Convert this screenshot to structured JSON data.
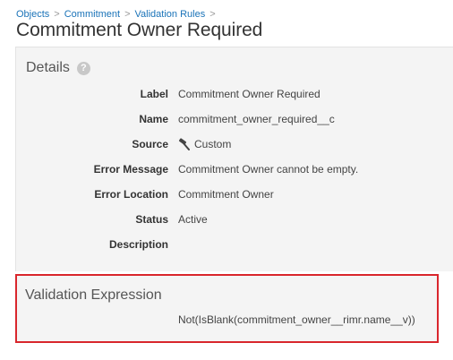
{
  "breadcrumb": {
    "items": [
      "Objects",
      "Commitment",
      "Validation Rules"
    ],
    "separator": ">"
  },
  "page_title": "Commitment Owner Required",
  "details": {
    "header": "Details",
    "help_icon": "?",
    "fields": [
      {
        "label": "Label",
        "value": "Commitment Owner Required"
      },
      {
        "label": "Name",
        "value": "commitment_owner_required__c"
      },
      {
        "label": "Source",
        "value": "Custom",
        "icon": "hammer-icon"
      },
      {
        "label": "Error Message",
        "value": "Commitment Owner cannot be empty."
      },
      {
        "label": "Error Location",
        "value": "Commitment Owner"
      },
      {
        "label": "Status",
        "value": "Active"
      },
      {
        "label": "Description",
        "value": ""
      }
    ]
  },
  "validation": {
    "header": "Validation Expression",
    "expression": "Not(IsBlank(commitment_owner__rimr.name__v))"
  },
  "colors": {
    "link": "#1a73b8",
    "panel_bg": "#f4f4f4",
    "highlight_border": "#d9262c"
  }
}
